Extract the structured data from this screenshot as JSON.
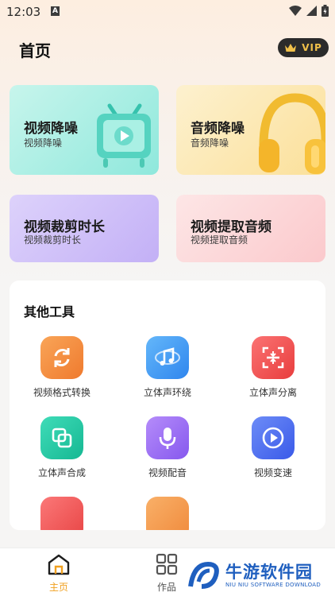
{
  "status_bar": {
    "time": "12:03",
    "a_glyph": "A"
  },
  "header": {
    "title": "首页",
    "vip_label": "VIP"
  },
  "cards": [
    {
      "title": "视频降噪",
      "subtitle": "视频降噪"
    },
    {
      "title": "音频降噪",
      "subtitle": "音频降噪"
    },
    {
      "title": "视频裁剪时长",
      "subtitle": "视频裁剪时长"
    },
    {
      "title": "视频提取音频",
      "subtitle": "视频提取音频"
    }
  ],
  "tools": {
    "title": "其他工具",
    "items": [
      {
        "label": "视频格式转换",
        "icon": "refresh-icon",
        "color": "#f38a3a"
      },
      {
        "label": "立体声环绕",
        "icon": "music-note-icon",
        "color": "#3e9ef5"
      },
      {
        "label": "立体声分离",
        "icon": "scan-split-icon",
        "color": "#ee4d4d"
      },
      {
        "label": "立体声合成",
        "icon": "merge-icon",
        "color": "#22c5a2"
      },
      {
        "label": "视频配音",
        "icon": "microphone-icon",
        "color": "#9a6bf2"
      },
      {
        "label": "视频变速",
        "icon": "play-icon",
        "color": "#4c6ff0"
      }
    ]
  },
  "nav": {
    "items": [
      {
        "label": "主页",
        "icon": "home-icon",
        "active": true,
        "color": "#f0a020"
      },
      {
        "label": "作品",
        "icon": "grid-icon",
        "active": false,
        "color": "#555555"
      }
    ]
  },
  "watermark": {
    "title": "牛游软件园",
    "subtitle": "NIU NIU SOFTWARE DOWNLOAD"
  }
}
